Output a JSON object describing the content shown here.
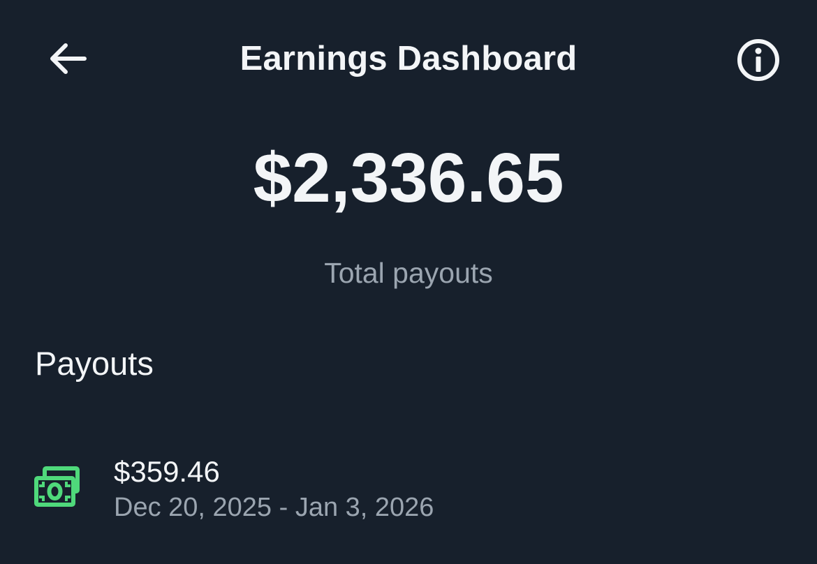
{
  "header": {
    "title": "Earnings Dashboard",
    "back_icon": "arrow-left-icon",
    "info_icon": "info-circle-icon"
  },
  "summary": {
    "total_amount": "$2,336.65",
    "total_label": "Total payouts"
  },
  "payouts": {
    "heading": "Payouts",
    "items": [
      {
        "amount": "$359.46",
        "date_range": "Dec 20, 2025 - Jan 3, 2026",
        "icon": "cash-icon"
      }
    ]
  },
  "colors": {
    "background": "#17202c",
    "text_primary": "#f3f5f7",
    "text_secondary": "#9ba5b0",
    "money_icon": "#4fd97b"
  }
}
